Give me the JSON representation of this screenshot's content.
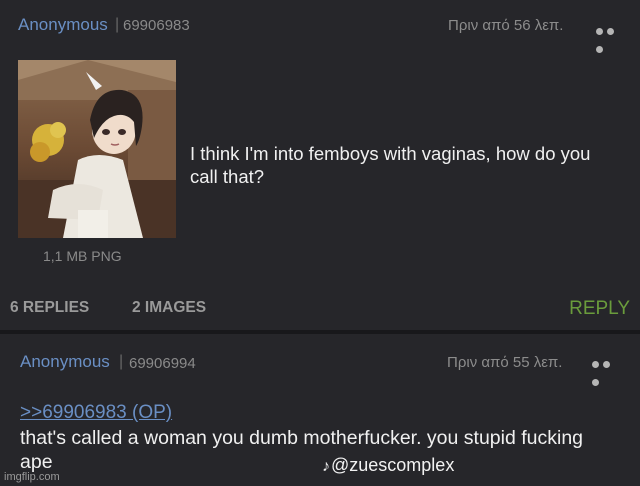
{
  "post1": {
    "name": "Anonymous",
    "separator": "|",
    "id": "69906983",
    "time": "Πριν από 56 λεπ.",
    "filesize": "1,1 MB PNG",
    "body": "I think I'm into femboys with vaginas, how do you call that?",
    "replies": "6 REPLIES",
    "images": "2 IMAGES",
    "reply_button": "REPLY"
  },
  "post2": {
    "name": "Anonymous",
    "separator": "|",
    "id": "69906994",
    "time": "Πριν από 55 λεπ.",
    "quote": ">>69906983 (OP)",
    "body": "that's called a woman you dumb motherfucker. you stupid fucking ape"
  },
  "watermark": "imgflip.com",
  "tiktok": {
    "icon": "tiktok-icon",
    "handle": "@zuescomplex"
  },
  "colors": {
    "link": "#6a8fc4",
    "reply": "#6a9c3c",
    "background": "#26262a"
  }
}
